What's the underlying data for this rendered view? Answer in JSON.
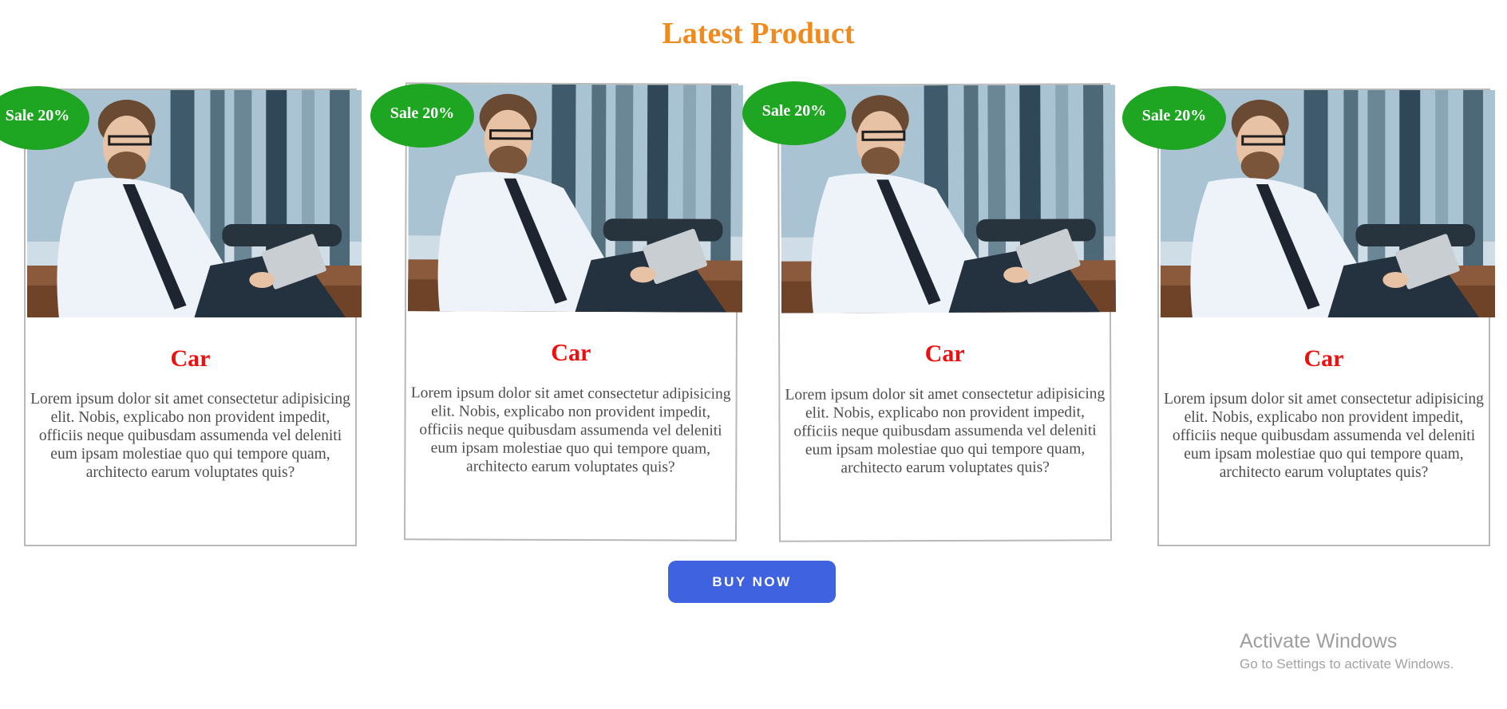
{
  "page": {
    "title": "Latest Product"
  },
  "products": [
    {
      "badge": "Sale 20%",
      "title": "Car",
      "description": "Lorem ipsum dolor sit amet consectetur adipisicing elit. Nobis, explicabo non provident impedit, officiis neque quibusdam assumenda vel deleniti eum ipsam molestiae quo qui tempore quam, architecto earum voluptates quis?"
    },
    {
      "badge": "Sale 20%",
      "title": "Car",
      "description": "Lorem ipsum dolor sit amet consectetur adipisicing elit. Nobis, explicabo non provident impedit, officiis neque quibusdam assumenda vel deleniti eum ipsam molestiae quo qui tempore quam, architecto earum voluptates quis?"
    },
    {
      "badge": "Sale 20%",
      "title": "Car",
      "description": "Lorem ipsum dolor sit amet consectetur adipisicing elit. Nobis, explicabo non provident impedit, officiis neque quibusdam assumenda vel deleniti eum ipsam molestiae quo qui tempore quam, architecto earum voluptates quis?"
    },
    {
      "badge": "Sale 20%",
      "title": "Car",
      "description": "Lorem ipsum dolor sit amet consectetur adipisicing elit. Nobis, explicabo non provident impedit, officiis neque quibusdam assumenda vel deleniti eum ipsam molestiae quo qui tempore quam, architecto earum voluptates quis?"
    }
  ],
  "cta": {
    "label": "BUY NOW"
  },
  "watermark": {
    "title": "Activate Windows",
    "subtitle": "Go to Settings to activate Windows."
  },
  "colors": {
    "heading": "#f08a1c",
    "card_title": "#f00d0d",
    "badge": "#1ea521",
    "button": "#3f62e0"
  },
  "icons": {
    "product_image": "man-with-tablet-photo"
  }
}
